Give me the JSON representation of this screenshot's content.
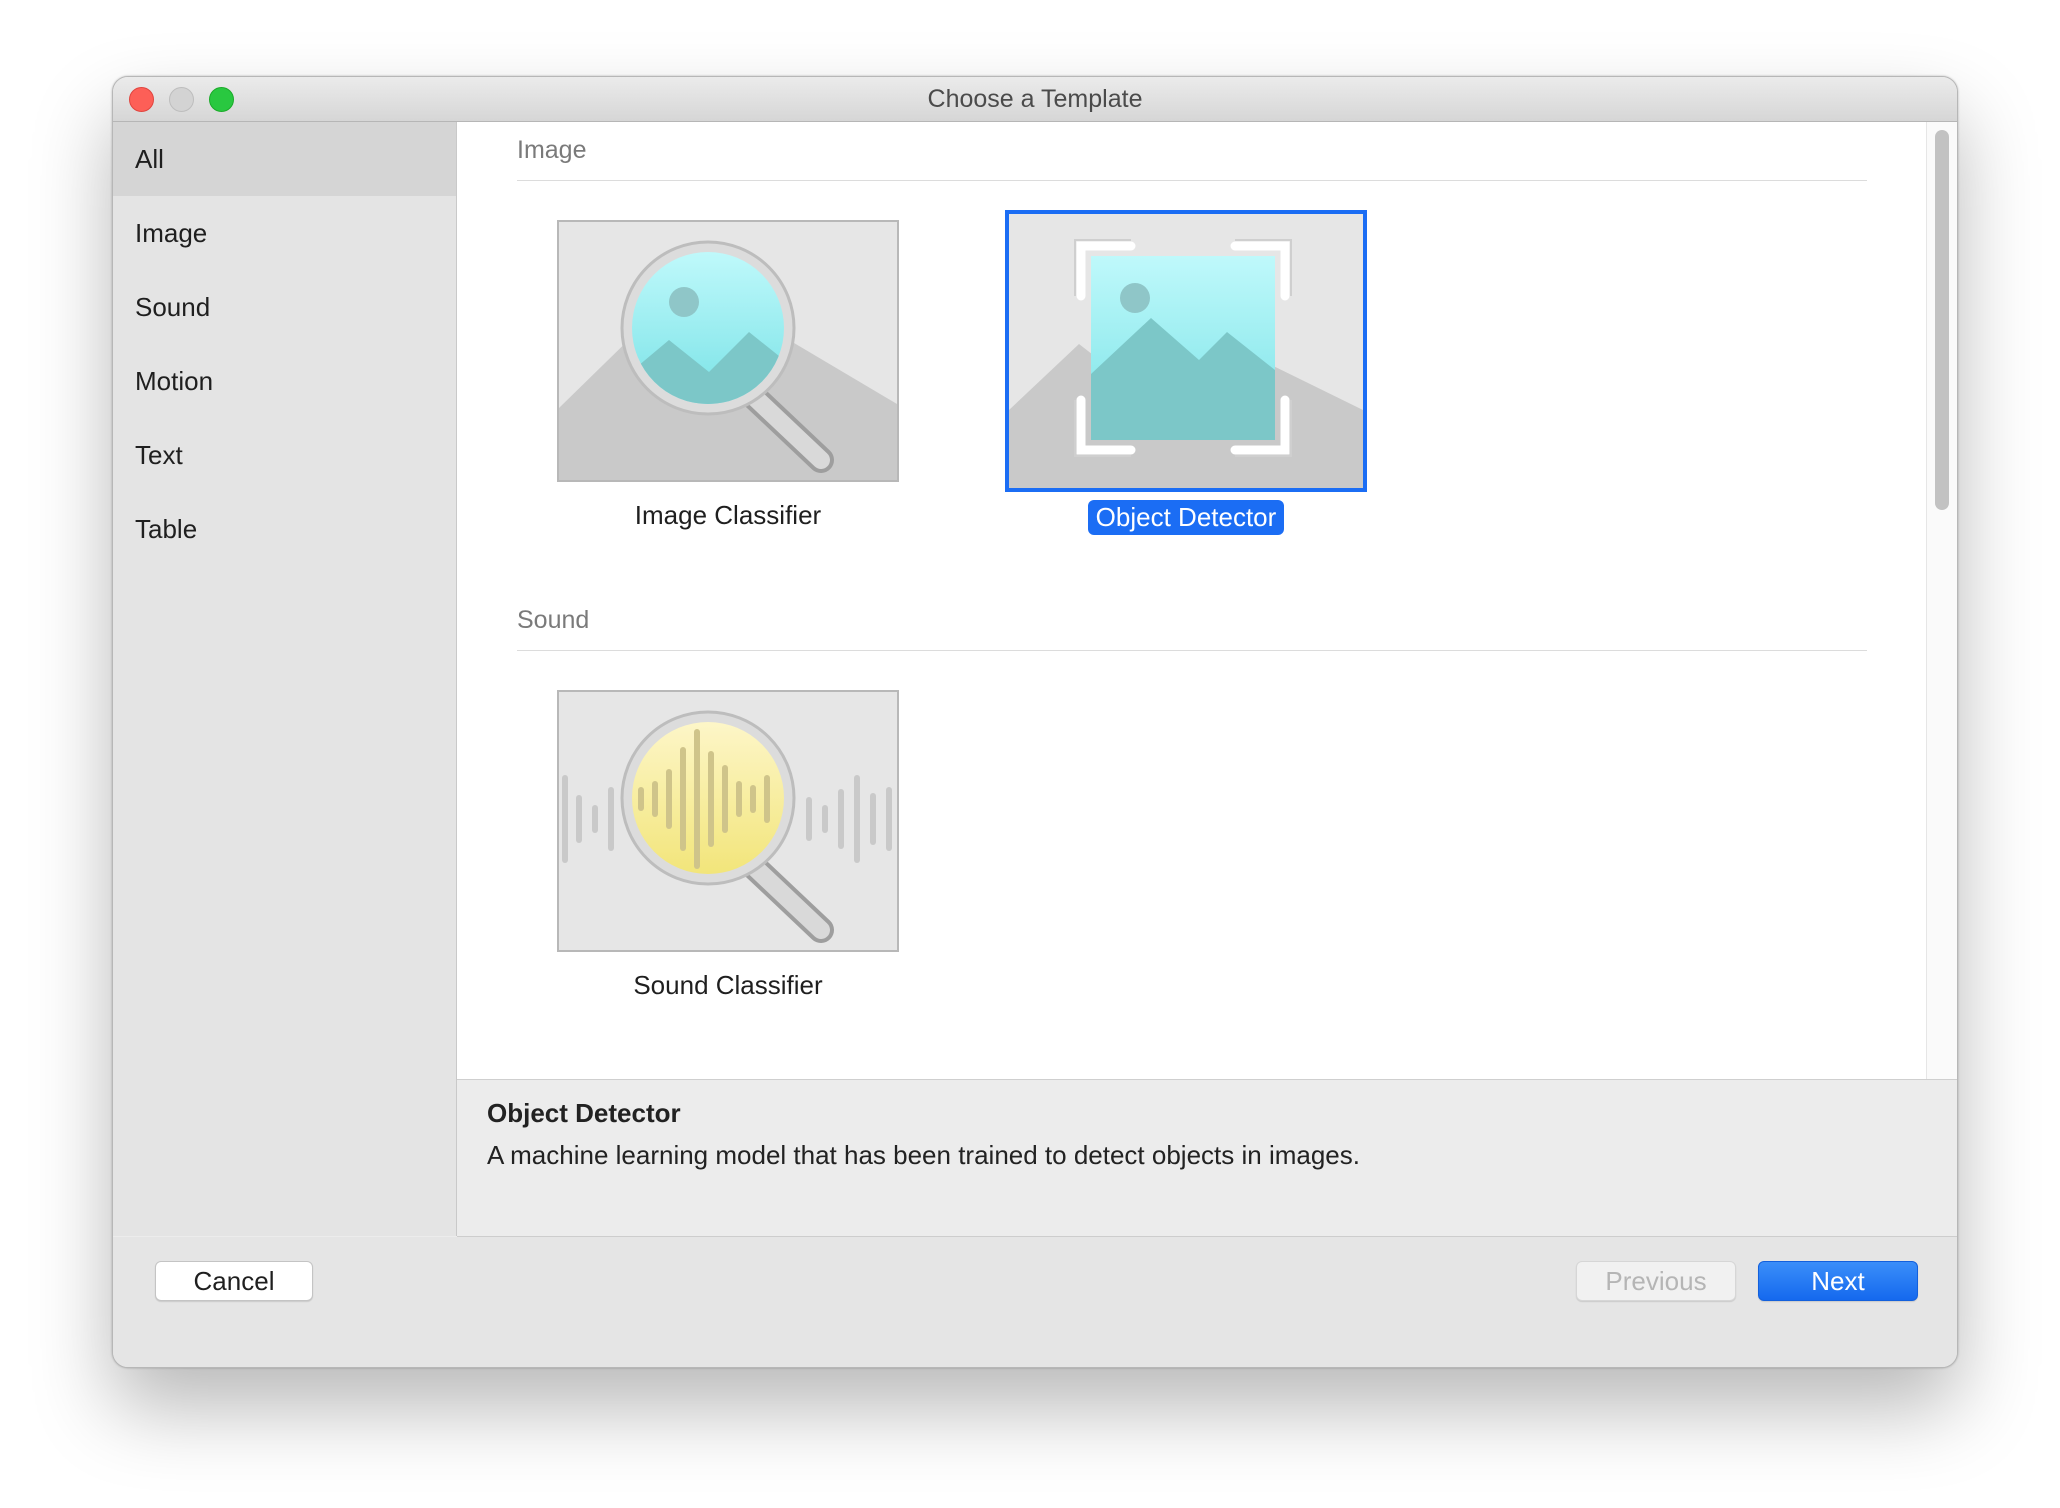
{
  "window": {
    "title": "Choose a Template"
  },
  "sidebar": {
    "items": [
      {
        "label": "All",
        "selected": true
      },
      {
        "label": "Image",
        "selected": false
      },
      {
        "label": "Sound",
        "selected": false
      },
      {
        "label": "Motion",
        "selected": false
      },
      {
        "label": "Text",
        "selected": false
      },
      {
        "label": "Table",
        "selected": false
      }
    ]
  },
  "sections": [
    {
      "title": "Image",
      "templates": [
        {
          "label": "Image Classifier",
          "icon": "image-classifier-icon",
          "selected": false
        },
        {
          "label": "Object Detector",
          "icon": "object-detector-icon",
          "selected": true
        }
      ]
    },
    {
      "title": "Sound",
      "templates": [
        {
          "label": "Sound Classifier",
          "icon": "sound-classifier-icon",
          "selected": false
        }
      ]
    }
  ],
  "details": {
    "title": "Object Detector",
    "description": "A machine learning model that has been trained to detect objects in images."
  },
  "footer": {
    "cancel": "Cancel",
    "previous": "Previous",
    "next": "Next"
  },
  "colors": {
    "accent": "#1b6df4",
    "close": "#fd5f57",
    "zoom": "#29c840"
  }
}
